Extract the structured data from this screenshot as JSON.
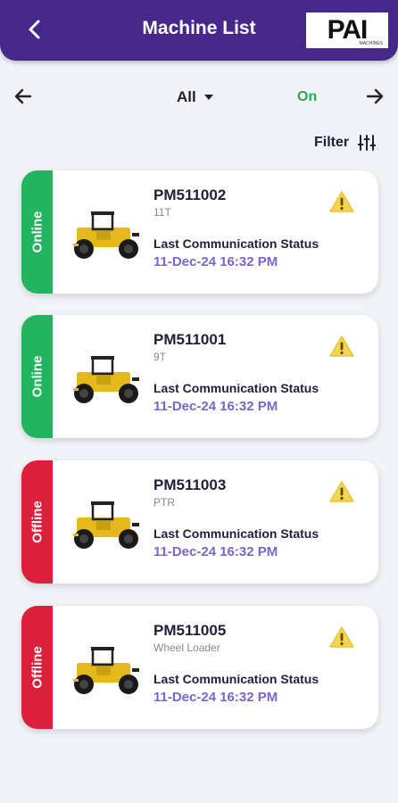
{
  "header": {
    "title": "Machine List",
    "logo_text": "PAI",
    "logo_sub": "MACHINES"
  },
  "filters": {
    "dropdown_value": "All",
    "status_toggle": "On",
    "filter_label": "Filter"
  },
  "colors": {
    "header": "#46288a",
    "online": "#22b45e",
    "offline": "#dc1f3c",
    "accent_time": "#7b66c7"
  },
  "machines": [
    {
      "status": "Online",
      "id": "PM511002",
      "type": "11T",
      "comm_label": "Last Communication Status",
      "comm_time": "11-Dec-24 16:32 PM"
    },
    {
      "status": "Online",
      "id": "PM511001",
      "type": "9T",
      "comm_label": "Last Communication Status",
      "comm_time": "11-Dec-24 16:32 PM"
    },
    {
      "status": "Offline",
      "id": "PM511003",
      "type": "PTR",
      "comm_label": "Last Communication Status",
      "comm_time": "11-Dec-24 16:32 PM"
    },
    {
      "status": "Offline",
      "id": "PM511005",
      "type": "Wheel Loader",
      "comm_label": "Last Communication Status",
      "comm_time": "11-Dec-24 16:32 PM"
    }
  ]
}
